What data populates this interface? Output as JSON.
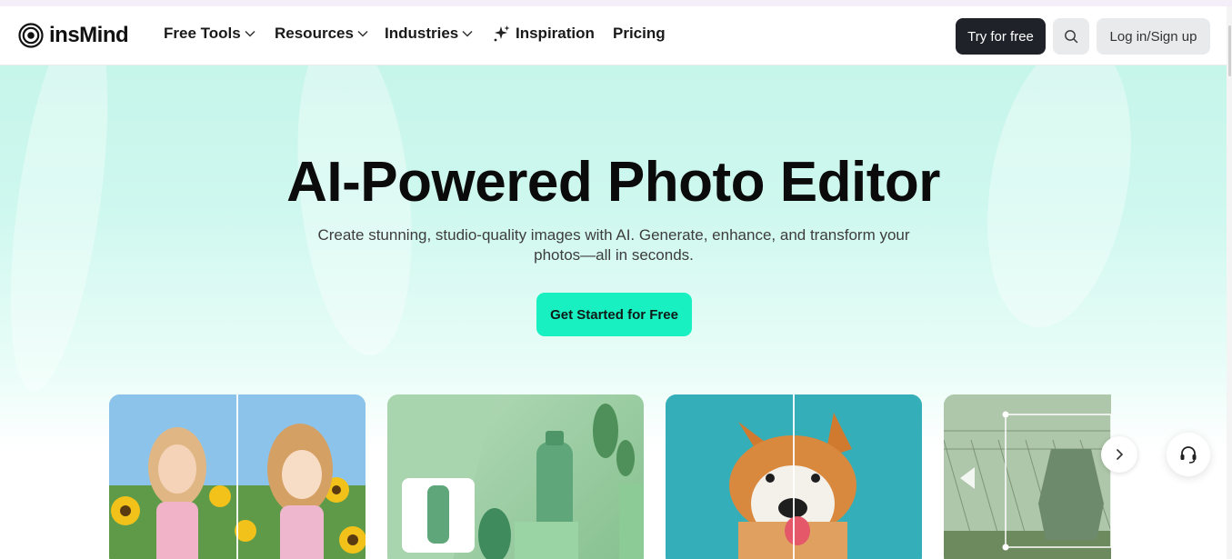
{
  "brand": {
    "name": "insMind"
  },
  "nav": {
    "items": [
      {
        "label": "Free Tools",
        "dropdown": true
      },
      {
        "label": "Resources",
        "dropdown": true
      },
      {
        "label": "Industries",
        "dropdown": true
      },
      {
        "label": "Inspiration",
        "icon": "sparkle-icon"
      },
      {
        "label": "Pricing"
      }
    ],
    "try_label": "Try for free",
    "login_label": "Log in/Sign up"
  },
  "hero": {
    "title": "AI-Powered Photo Editor",
    "subtitle": "Create stunning, studio-quality images with AI. Generate, enhance, and transform your photos—all in seconds.",
    "cta_label": "Get Started for Free"
  },
  "colors": {
    "accent": "#19f0c1",
    "dark_button": "#1f2329",
    "hero_bg": "#c6f5ea"
  }
}
